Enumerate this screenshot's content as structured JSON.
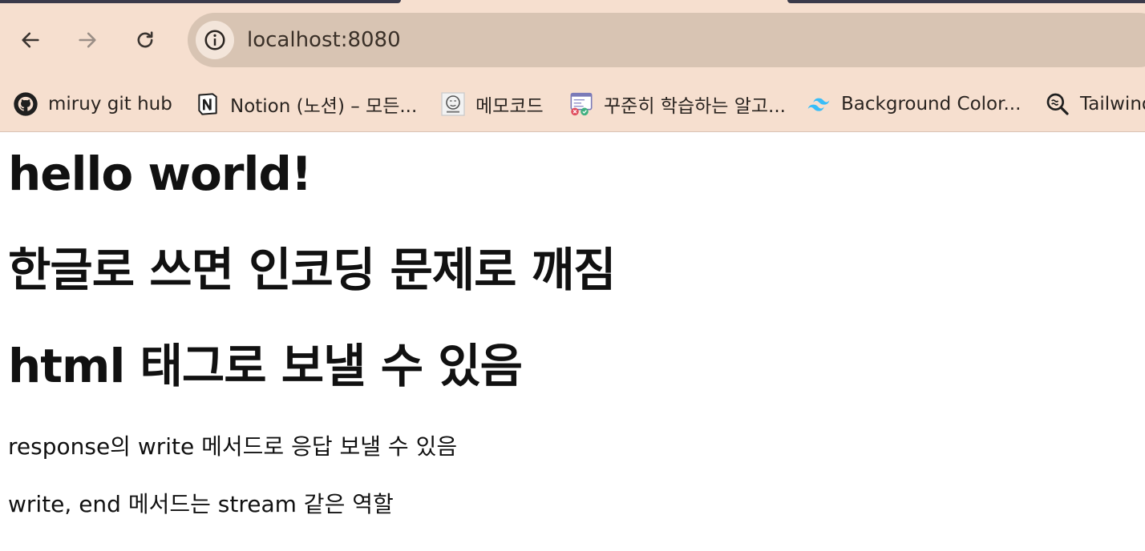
{
  "browser": {
    "url": "localhost:8080",
    "nav": {
      "back_icon": "arrow-left-icon",
      "forward_icon": "arrow-right-icon",
      "reload_icon": "reload-icon",
      "site_info_icon": "info-icon"
    },
    "bookmarks": [
      {
        "label": "miruy git hub",
        "icon": "github-icon"
      },
      {
        "label": "Notion (노션) – 모든...",
        "icon": "notion-icon"
      },
      {
        "label": "메모코드",
        "icon": "memocode-icon"
      },
      {
        "label": "꾸준히 학습하는 알고...",
        "icon": "algorithm-icon"
      },
      {
        "label": "Background Color...",
        "icon": "tailwind-icon"
      },
      {
        "label": "Tailwind",
        "icon": "search-zoom-icon"
      }
    ],
    "colors": {
      "chrome": "#f6dfcf",
      "omnibox": "#d8c4b3"
    }
  },
  "page": {
    "headings": [
      "hello world!",
      "한글로 쓰면 인코딩 문제로 깨짐",
      "html 태그로 보낼 수 있음"
    ],
    "paragraphs": [
      "response의 write 메서드로 응답 보낼 수 있음",
      "write, end 메서드는 stream 같은 역할"
    ]
  }
}
